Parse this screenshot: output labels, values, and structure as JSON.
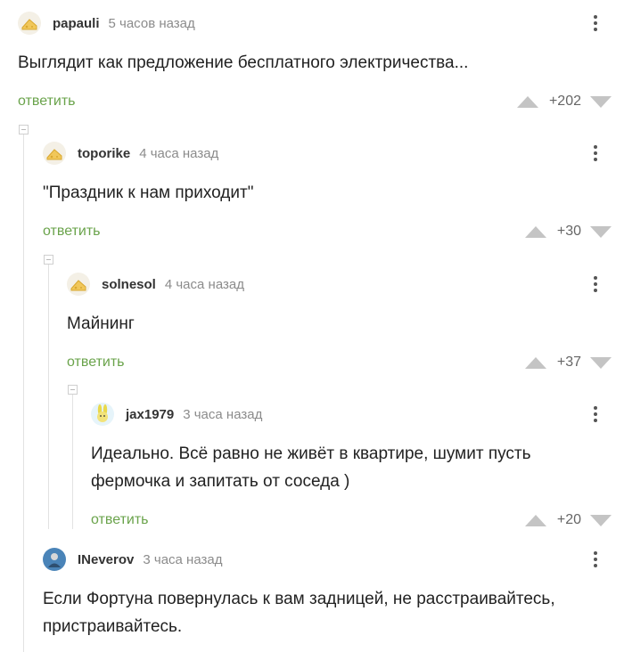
{
  "comments": [
    {
      "username": "papauli",
      "time": "5 часов назад",
      "text": "Выглядит как предложение бесплатного электричества...",
      "reply": "ответить",
      "rating": "+202",
      "avatar": "cheese-avatar"
    },
    {
      "username": "toporike",
      "time": "4 часа назад",
      "text": "\"Праздник к нам приходит\"",
      "reply": "ответить",
      "rating": "+30",
      "avatar": "cheese-avatar"
    },
    {
      "username": "solnesol",
      "time": "4 часа назад",
      "text": "Майнинг",
      "reply": "ответить",
      "rating": "+37",
      "avatar": "cheese-avatar"
    },
    {
      "username": "jax1979",
      "time": "3 часа назад",
      "text": "Идеально. Всё равно не живёт в квартире, шумит пусть фермочка и запитать от соседа )",
      "reply": "ответить",
      "rating": "+20",
      "avatar": "bunny-avatar"
    },
    {
      "username": "INeverov",
      "time": "3 часа назад",
      "text": "Если Фортуна повернулась к вам задницей, не расстраивайтесь, пристраивайтесь.",
      "avatar": "man-avatar"
    }
  ],
  "colors": {
    "reply": "#6aa34b",
    "arrow": "#c4c4c4",
    "time": "#8b8b8b",
    "thread_line": "#e2e2e2"
  },
  "icons": [
    "more-vertical-icon",
    "upvote-arrow-icon",
    "downvote-arrow-icon",
    "collapse-thread-icon"
  ]
}
